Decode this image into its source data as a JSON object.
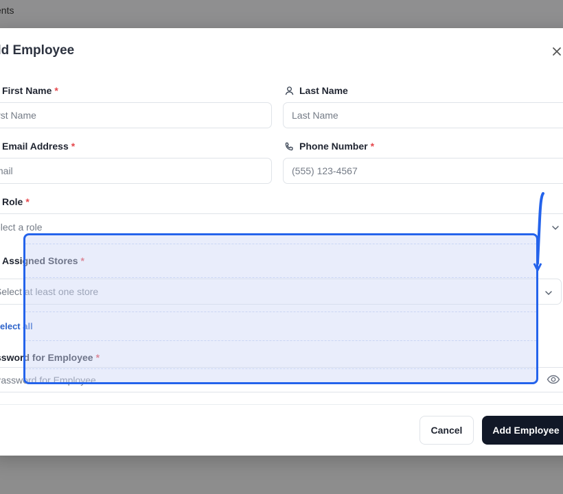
{
  "background": {
    "partial_label": "ents"
  },
  "modal": {
    "title": "dd Employee",
    "fields": {
      "first_name": {
        "label": "First Name",
        "required": "*",
        "placeholder": "irst Name"
      },
      "last_name": {
        "label": "Last Name",
        "placeholder": "Last Name"
      },
      "email": {
        "label": "Email Address",
        "required": "*",
        "placeholder": "mail"
      },
      "phone": {
        "label": "Phone Number",
        "required": "*",
        "placeholder": "(555) 123-4567"
      },
      "role": {
        "label": "Role",
        "required": "*",
        "placeholder": "elect a role"
      },
      "stores": {
        "label": "Assigned Stores",
        "required": "*",
        "placeholder": "Select at least one store",
        "select_all": "elect all"
      },
      "password": {
        "label": "ssword for Employee",
        "required": "*",
        "placeholder": "Password for Employee"
      }
    },
    "buttons": {
      "cancel": "Cancel",
      "submit": "Add Employee"
    }
  },
  "colors": {
    "accent": "#2463eb",
    "required": "#e5484d",
    "primary_button": "#111827"
  },
  "icons": {
    "close": "close-icon",
    "user": "user-icon",
    "phone": "phone-icon",
    "chevron": "chevron-down-icon",
    "eye": "eye-icon"
  }
}
